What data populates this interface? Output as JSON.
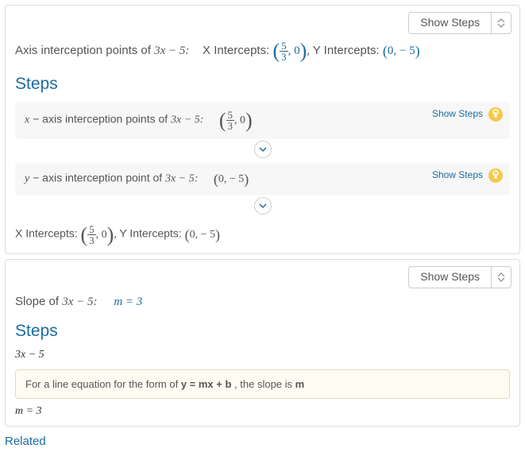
{
  "common": {
    "show_steps_label": "Show Steps",
    "steps_heading": "Steps",
    "related_label": "Related"
  },
  "section1": {
    "title_prefix": "Axis interception points of ",
    "expr": "3x − 5",
    "xint_label": "X Intercepts:",
    "yint_label": "Y Intercepts:",
    "xint_frac_num": "5",
    "xint_frac_den": "3",
    "xint_y": "0",
    "yint_x": "0",
    "yint_y": "− 5",
    "sub_x": {
      "var": "x",
      "text": " − axis interception points of ",
      "expr": "3x − 5",
      "res_frac_num": "5",
      "res_frac_den": "3",
      "res_y": "0",
      "show": "Show Steps"
    },
    "sub_y": {
      "var": "y",
      "text": " − axis interception point of ",
      "expr": "3x − 5",
      "res_x": "0",
      "res_y": "− 5",
      "show": "Show Steps"
    },
    "result": {
      "xlabel": "X Intercepts:",
      "frac_num": "5",
      "frac_den": "3",
      "xy": "0",
      "ylabel": "Y Intercepts:",
      "yx": "0",
      "yy": "− 5"
    }
  },
  "section2": {
    "title_prefix": "Slope of ",
    "expr": "3x − 5",
    "result_expr": "m = 3",
    "step_expr": "3x − 5",
    "hint_prefix": "For a line equation for the form of ",
    "hint_bold": "y = mx + b",
    "hint_mid": ", the slope is ",
    "hint_m": "m",
    "final": "m = 3"
  }
}
